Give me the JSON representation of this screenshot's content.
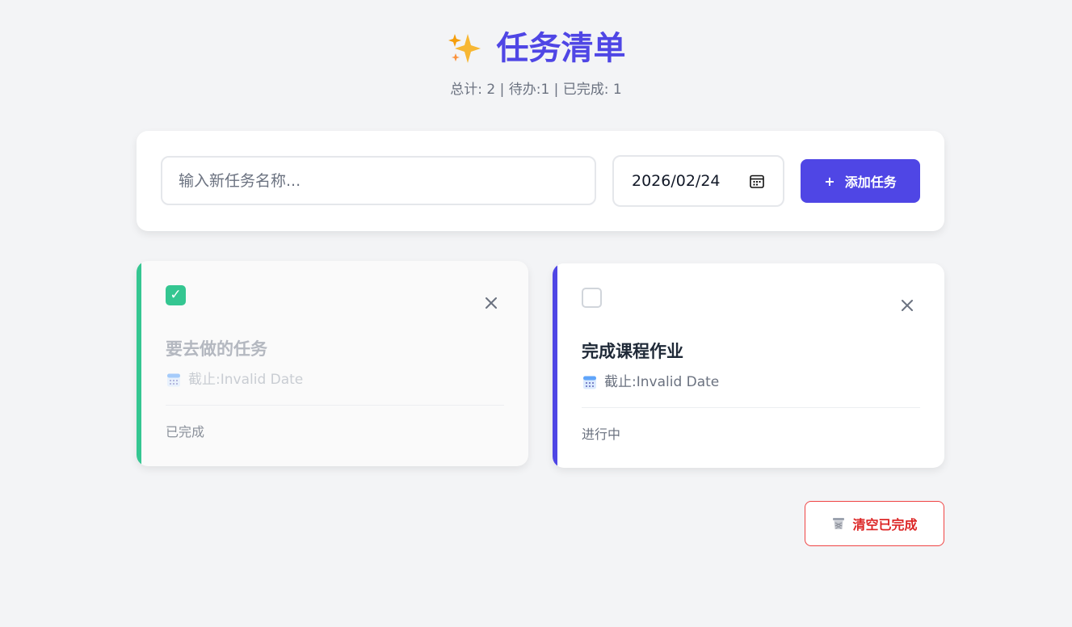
{
  "header": {
    "icon": "sparkles-icon",
    "title": "任务清单",
    "stats": "总计: 2 | 待办:1 | 已完成: 1"
  },
  "form": {
    "task_placeholder": "输入新任务名称...",
    "task_value": "",
    "date_value": "2026/02/24",
    "date_icon": "calendar-icon",
    "add_icon": "+",
    "add_label": "添加任务"
  },
  "tasks": [
    {
      "name": "要去做的任务",
      "deadline": "截止:Invalid Date",
      "status": "已完成",
      "completed": true,
      "accent": "#34c691",
      "check_mark": "✓"
    },
    {
      "name": "完成课程作业",
      "deadline": "截止:Invalid Date",
      "status": "进行中",
      "completed": false,
      "accent": "#4f46e5"
    }
  ],
  "footer": {
    "clear_icon": "trash-icon",
    "clear_label": "清空已完成"
  },
  "colors": {
    "primary": "#4f46e5",
    "done": "#34c691",
    "danger": "#dc2626",
    "background": "#f3f4f6"
  }
}
